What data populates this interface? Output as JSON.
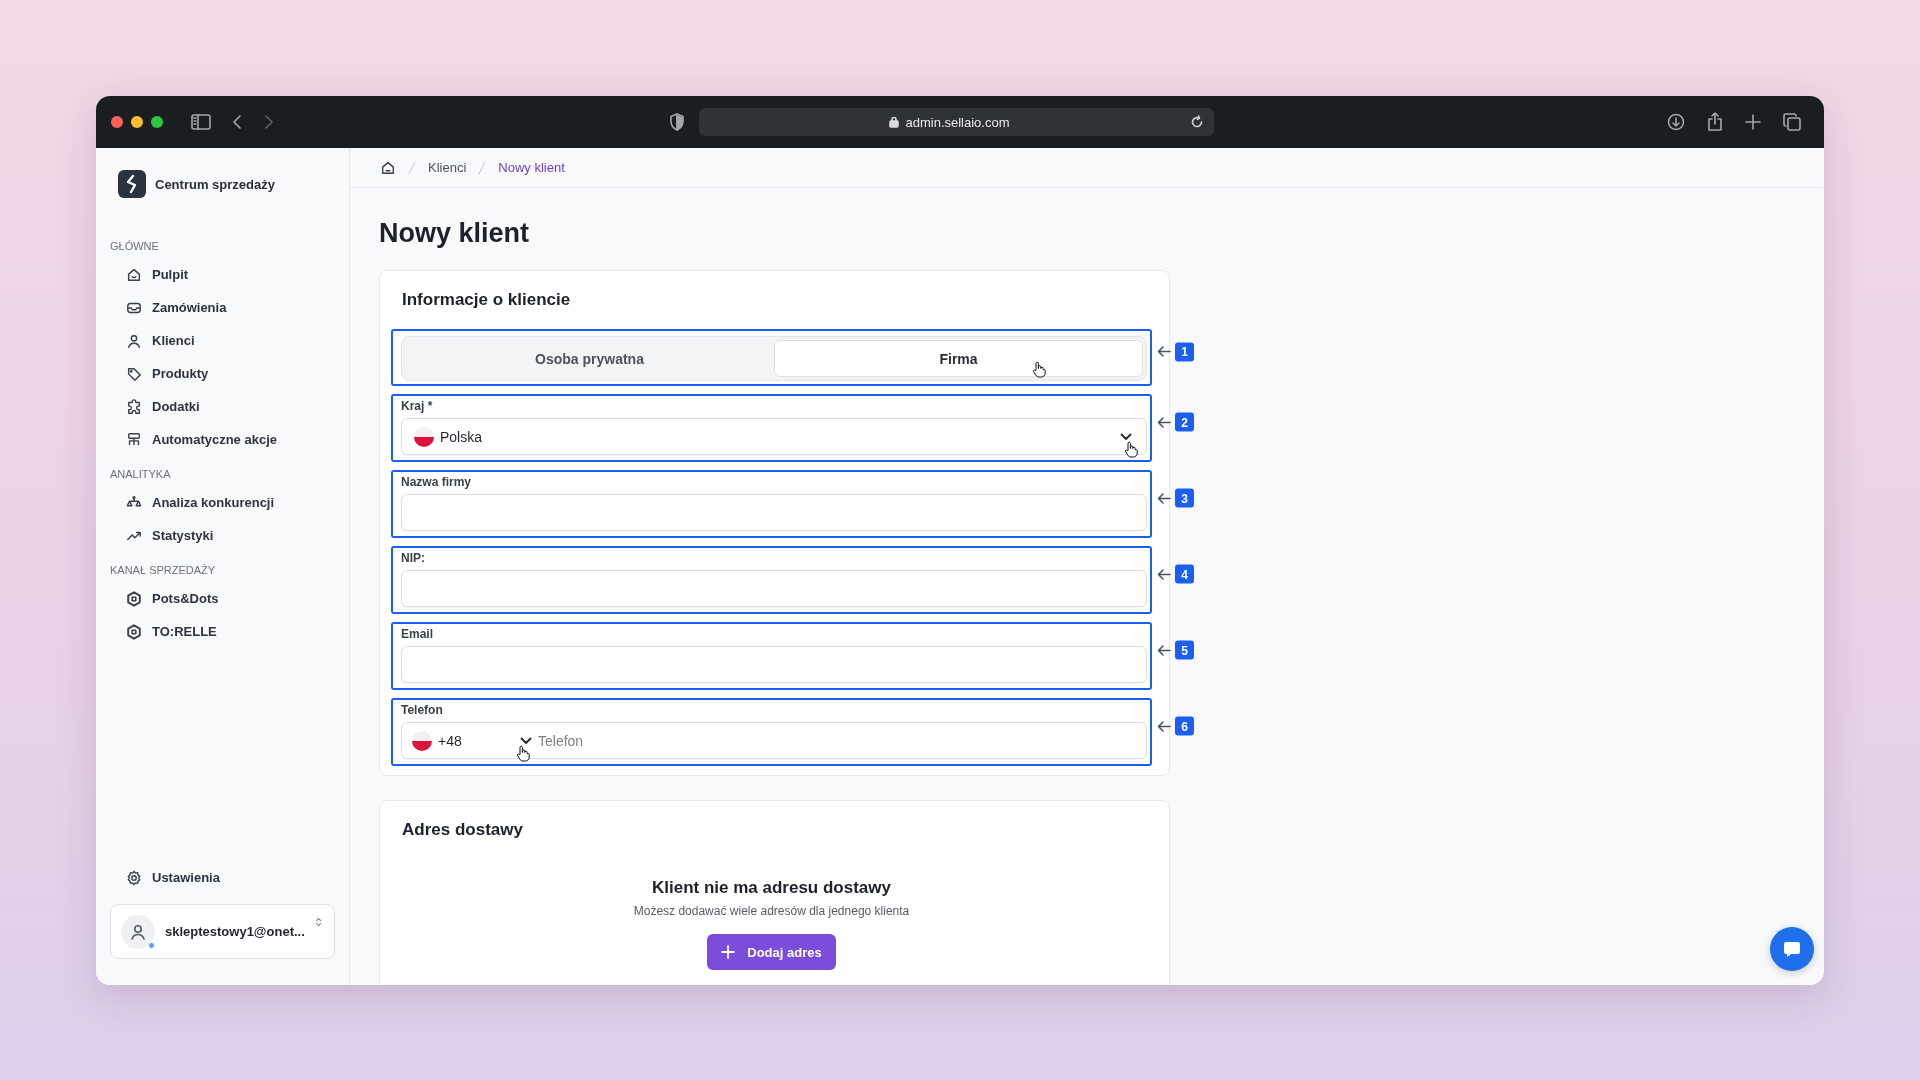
{
  "browser": {
    "url": "admin.sellaio.com"
  },
  "sidebar": {
    "brand": "Centrum sprzedaży",
    "sections": [
      {
        "label": "GŁÓWNE",
        "items": [
          {
            "label": "Pulpit"
          },
          {
            "label": "Zamówienia"
          },
          {
            "label": "Klienci"
          },
          {
            "label": "Produkty"
          },
          {
            "label": "Dodatki"
          },
          {
            "label": "Automatyczne akcje"
          }
        ]
      },
      {
        "label": "ANALITYKA",
        "items": [
          {
            "label": "Analiza konkurencji"
          },
          {
            "label": "Statystyki"
          }
        ]
      },
      {
        "label": "KANAŁ SPRZEDAŻY",
        "items": [
          {
            "label": "Pots&Dots"
          },
          {
            "label": "TO:RELLE"
          }
        ]
      }
    ],
    "settings": "Ustawienia",
    "user": "skleptestowy1@onet..."
  },
  "breadcrumb": [
    "Klienci",
    "Nowy klient"
  ],
  "page_title": "Nowy klient",
  "client_card": {
    "title": "Informacje o kliencie",
    "fields": [
      {
        "kind": "segmented",
        "marker": "1",
        "options": [
          {
            "label": "Osoba prywatna",
            "selected": false
          },
          {
            "label": "Firma",
            "selected": true
          }
        ]
      },
      {
        "kind": "select",
        "marker": "2",
        "label": "Kraj *",
        "value": "Polska"
      },
      {
        "kind": "text",
        "marker": "3",
        "label": "Nazwa firmy"
      },
      {
        "kind": "text",
        "marker": "4",
        "label": "NIP:"
      },
      {
        "kind": "text",
        "marker": "5",
        "label": "Email"
      },
      {
        "kind": "phone",
        "marker": "6",
        "label": "Telefon",
        "code": "+48",
        "placeholder": "Telefon"
      }
    ]
  },
  "address_card": {
    "title": "Adres dostawy",
    "empty_title": "Klient nie ma adresu dostawy",
    "empty_text": "Możesz dodawać wiele adresów dla jednego klienta",
    "button": "Dodaj adres"
  }
}
